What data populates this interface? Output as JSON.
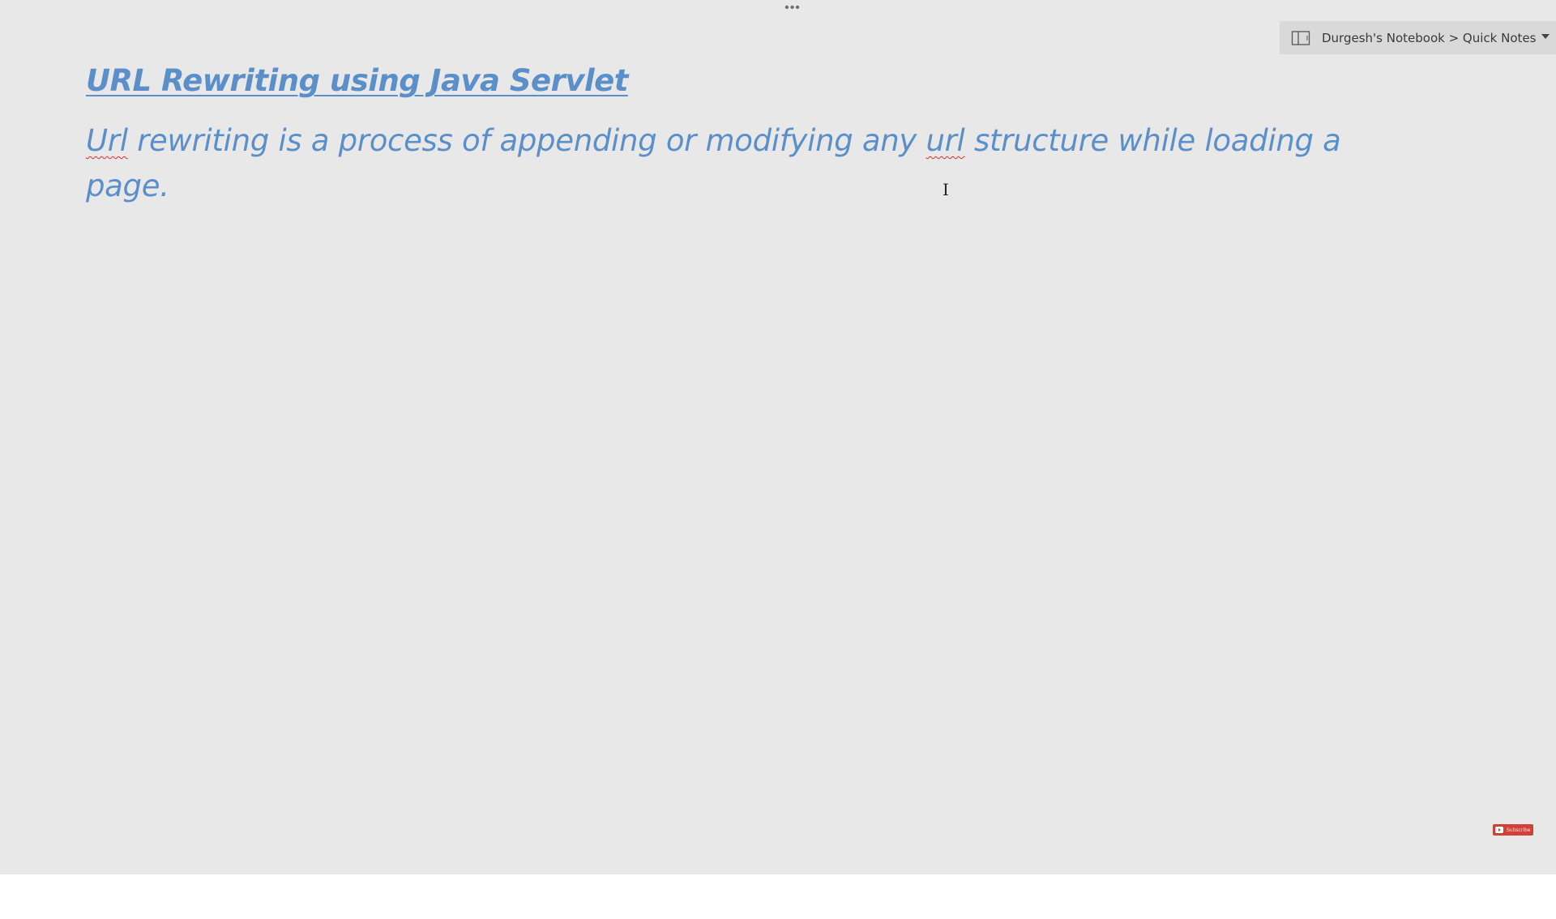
{
  "toolbar": {
    "more_label": "•••"
  },
  "location": {
    "icon": "notebook-icon",
    "label": "Durgesh's Notebook > Quick Notes"
  },
  "note": {
    "title": "URL Rewriting using Java Servlet",
    "body_parts": {
      "w1": "Url",
      "t1": " rewriting is a process of appending or modifying any ",
      "w2": "url",
      "t2": " structure while loading a page."
    }
  },
  "overlay": {
    "cursor_glyph": "I",
    "subscribe_label": "Subscribe"
  },
  "colors": {
    "text_blue": "#5b8fc9",
    "canvas_bg": "#e8e8e8",
    "spellcheck_red": "#e0302f"
  }
}
